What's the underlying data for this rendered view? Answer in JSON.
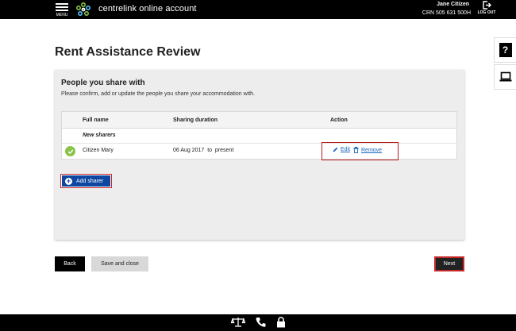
{
  "header": {
    "menu_label": "MENU",
    "app_name": "centrelink online account",
    "user_name": "Jane Citizen",
    "crn": "CRN 505 631 500H",
    "logout_label": "LOG OUT"
  },
  "page": {
    "title": "Rent Assistance Review"
  },
  "side_tabs": {
    "help_label": "?"
  },
  "panel": {
    "title": "People you share with",
    "description": "Please confirm, add or update the people you share your accommodation with.",
    "table": {
      "columns": [
        "Full name",
        "Sharing duration",
        "Action"
      ],
      "group_label": "New sharers",
      "rows": [
        {
          "name": "Citizen Mary",
          "duration": "06 Aug 2017  to  present",
          "edit_label": "Edit",
          "remove_label": "Remove"
        }
      ]
    },
    "add_button_label": "Add sharer"
  },
  "actions": {
    "back_label": "Back",
    "save_label": "Save and close",
    "next_label": "Next"
  },
  "colors": {
    "header_bg": "#000000",
    "primary_blue": "#0d47a1",
    "link_blue": "#1565c0",
    "success_green": "#8bc34a",
    "highlight_red": "#c62828"
  }
}
